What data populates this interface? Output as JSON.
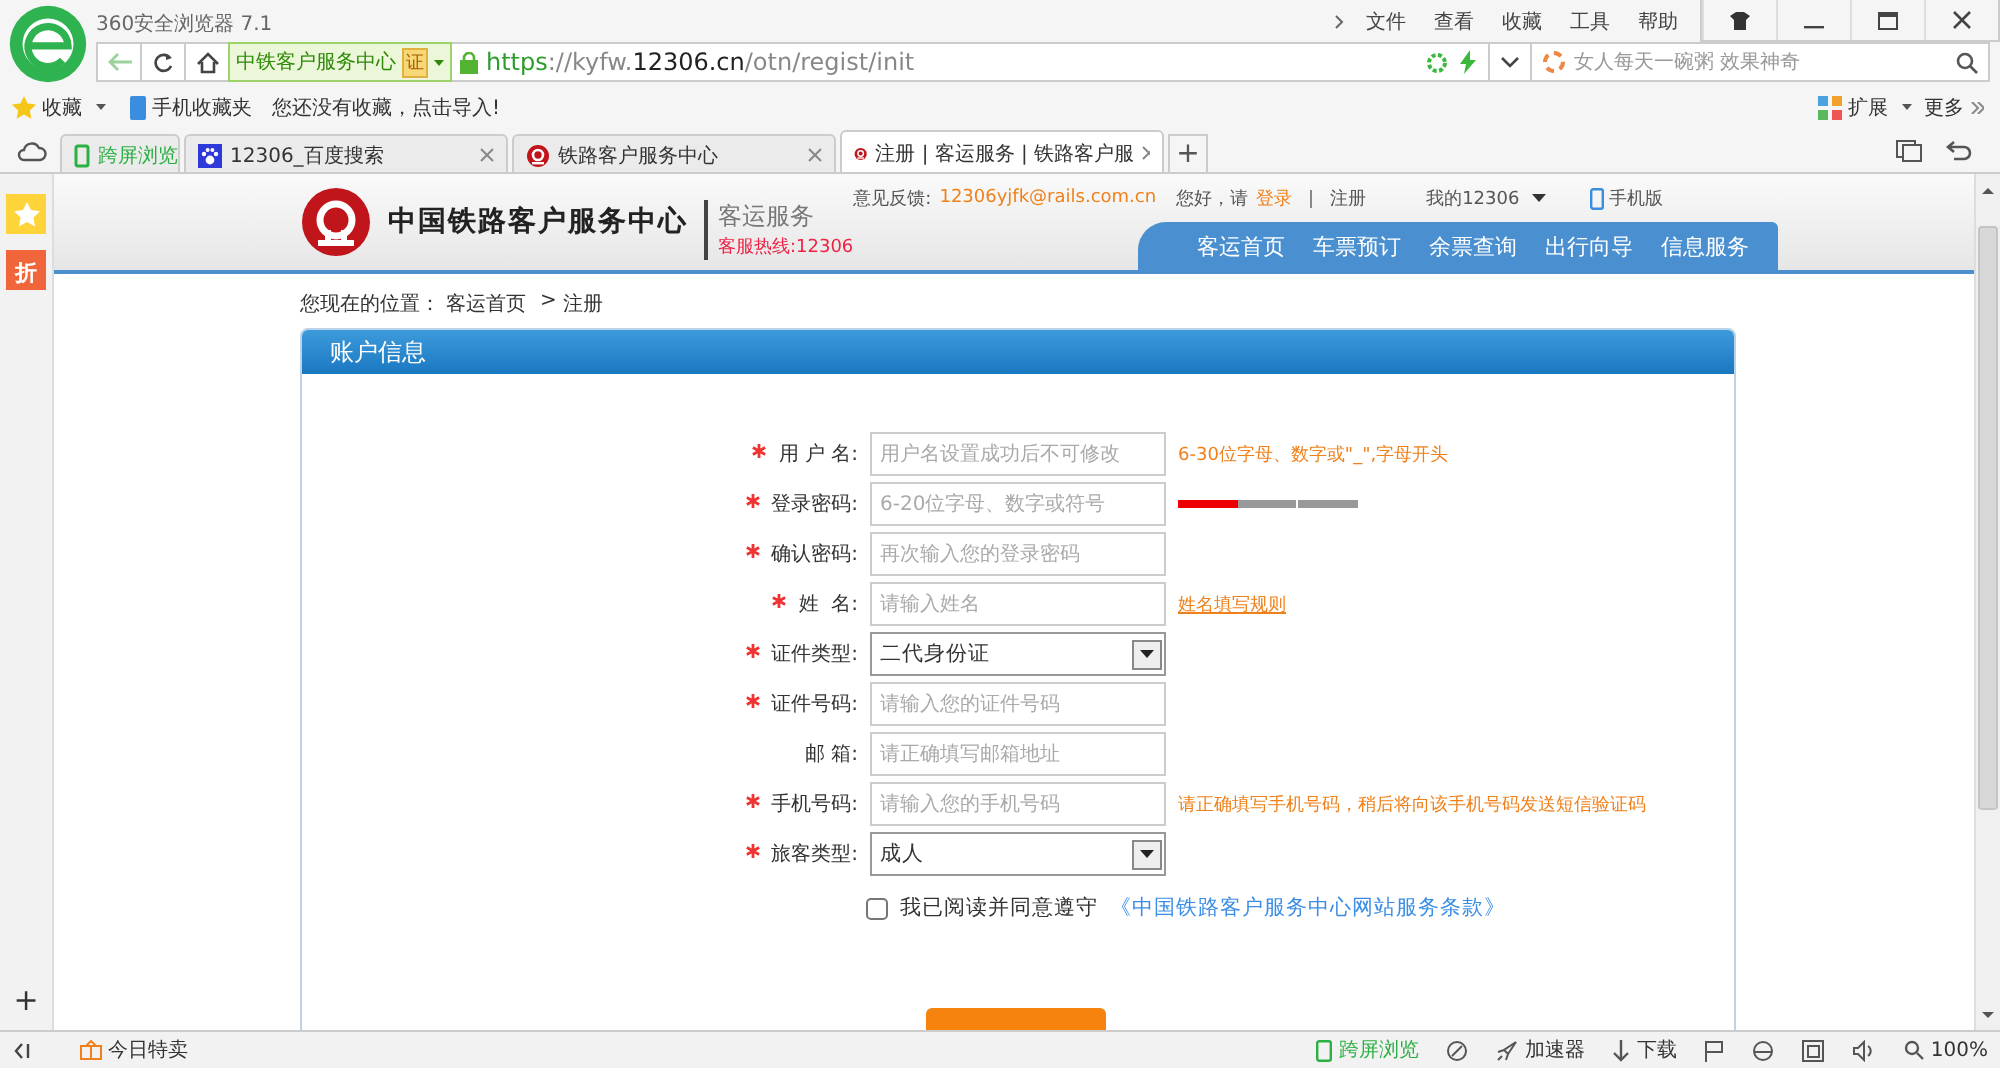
{
  "browser": {
    "title": "360安全浏览器 7.1",
    "menu": [
      "文件",
      "查看",
      "收藏",
      "工具",
      "帮助"
    ],
    "site_badge": "中铁客户服务中心",
    "cert_badge": "证",
    "url_scheme": "https",
    "url_host": "://kyfw.12306.cn",
    "url_path": "/otn/regist/init",
    "search": {
      "placeholder": "女人每天一碗粥 效果神奇"
    },
    "bookmarks": [
      {
        "label": "收藏",
        "kind": "menu"
      },
      {
        "label": "手机收藏夹",
        "kind": "phone"
      },
      {
        "label": "您还没有收藏，点击导入!",
        "kind": "note"
      }
    ],
    "extensions": "扩展",
    "more": "更多",
    "tabs": [
      {
        "label": "跨屏浏览",
        "kind": "pinned",
        "selected": false
      },
      {
        "label": "12306_百度搜索",
        "kind": "paw",
        "selected": false
      },
      {
        "label": "铁路客户服务中心",
        "kind": "rail",
        "selected": false
      },
      {
        "label": "注册 | 客运服务 | 铁路客户服",
        "kind": "rail",
        "selected": true
      }
    ],
    "new_tab": "+"
  },
  "sidebar": {
    "items": [
      {
        "kind": "star"
      },
      {
        "kind": "discount",
        "label": "折"
      }
    ],
    "add": "+"
  },
  "site": {
    "logo_text": "中国铁路客户服务中心",
    "section": "客运服务",
    "hotline": "客服热线:12306",
    "feedback_label": "意见反馈:",
    "feedback_email": "12306yjfk@rails.com.cn",
    "greeting": "您好，请",
    "login": "登录",
    "register": "注册",
    "my12306": "我的12306",
    "mobile": "手机版",
    "nav": [
      "客运首页",
      "车票预订",
      "余票查询",
      "出行向导",
      "信息服务"
    ],
    "breadcrumb": [
      {
        "label": "您现在的位置：",
        "kind": "text"
      },
      {
        "label": "客运首页",
        "kind": "link"
      },
      {
        "label": ">",
        "kind": "sep"
      },
      {
        "label": "注册",
        "kind": "text"
      }
    ]
  },
  "form": {
    "title": "账户信息",
    "fields": [
      {
        "label": "用 户 名:",
        "required": true,
        "kind": "text",
        "placeholder": "用户名设置成功后不可修改",
        "hint": {
          "kind": "note",
          "text": "6-30位字母、数字或\"_\",字母开头"
        }
      },
      {
        "label": "登录密码:",
        "required": true,
        "kind": "text",
        "placeholder": "6-20位字母、数字或符号",
        "strength": {
          "level": 0.33
        }
      },
      {
        "label": "确认密码:",
        "required": true,
        "kind": "text",
        "placeholder": "再次输入您的登录密码"
      },
      {
        "label": "姓  名:",
        "required": true,
        "kind": "text",
        "placeholder": "请输入姓名",
        "hint": {
          "kind": "link",
          "text": "姓名填写规则"
        }
      },
      {
        "label": "证件类型:",
        "required": true,
        "kind": "select",
        "value": "二代身份证"
      },
      {
        "label": "证件号码:",
        "required": true,
        "kind": "text",
        "placeholder": "请输入您的证件号码"
      },
      {
        "label": "邮 箱:",
        "required": false,
        "kind": "text",
        "placeholder": "请正确填写邮箱地址"
      },
      {
        "label": "手机号码:",
        "required": true,
        "kind": "text",
        "placeholder": "请输入您的手机号码",
        "hint": {
          "kind": "note",
          "text": "请正确填写手机号码，稍后将向该手机号码发送短信验证码"
        }
      },
      {
        "label": "旅客类型:",
        "required": true,
        "kind": "select",
        "value": "成人"
      }
    ],
    "agree": {
      "checked": false,
      "text": "我已阅读并同意遵守",
      "link": "《中国铁路客户服务中心网站服务条款》"
    }
  },
  "status_bar": {
    "promo": "今日特卖",
    "cross_screen": "跨屏浏览",
    "accelerator": "加速器",
    "download": "下载",
    "zoom": "100%"
  }
}
